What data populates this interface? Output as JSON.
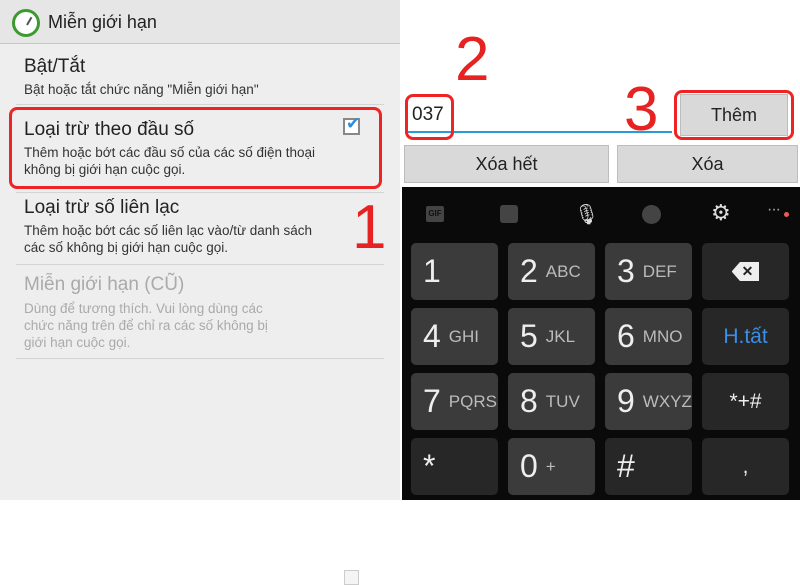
{
  "settings": {
    "title": "Miễn giới hạn",
    "items": [
      {
        "title": "Bật/Tắt",
        "desc": "Bật hoặc tắt chức năng \"Miễn giới hạn\"",
        "checked": true
      },
      {
        "title": "Loại trừ theo đầu số",
        "desc1": "Thêm hoặc bớt các đầu số của các số điện thoại",
        "desc2": "không bị giới hạn cuộc gọi."
      },
      {
        "title": "Loại trừ số liên lạc",
        "desc1": "Thêm hoặc bớt các số liên lạc vào/từ danh sách",
        "desc2": "các số không bị giới hạn cuộc gọi."
      },
      {
        "title": "Miễn giới hạn (CŨ)",
        "desc1": "Dùng để tương thích. Vui lòng dùng các",
        "desc2": "chức năng trên để chỉ ra các số không bị",
        "desc3": "giới hạn cuộc gọi.",
        "checked": false,
        "disabled": true
      }
    ]
  },
  "annotations": {
    "step1": "1",
    "step2": "2",
    "step3": "3",
    "color": "#e72222"
  },
  "dialog": {
    "input_value": "037",
    "add_label": "Thêm",
    "clear_all_label": "Xóa hết",
    "delete_label": "Xóa"
  },
  "keyboard": {
    "toolbar": [
      "gif-icon",
      "sticker-icon",
      "mic-icon",
      "emoji-icon",
      "gear-icon",
      "more-icon"
    ],
    "gif": "GIF",
    "keys": [
      {
        "d": "1",
        "l": ""
      },
      {
        "d": "2",
        "l": "ABC"
      },
      {
        "d": "3",
        "l": "DEF"
      },
      {
        "icon": "backspace-icon"
      },
      {
        "d": "4",
        "l": "GHI"
      },
      {
        "d": "5",
        "l": "JKL"
      },
      {
        "d": "6",
        "l": "MNO"
      },
      {
        "d": "H.tất",
        "accent": "#3a8ee6"
      },
      {
        "d": "7",
        "l": "PQRS"
      },
      {
        "d": "8",
        "l": "TUV"
      },
      {
        "d": "9",
        "l": "WXYZ"
      },
      {
        "d": "*+#"
      },
      {
        "d": "*",
        "l": ""
      },
      {
        "d": "0",
        "l": "+"
      },
      {
        "d": "#",
        "l": ""
      },
      {
        "d": ",",
        "l": ""
      }
    ]
  }
}
